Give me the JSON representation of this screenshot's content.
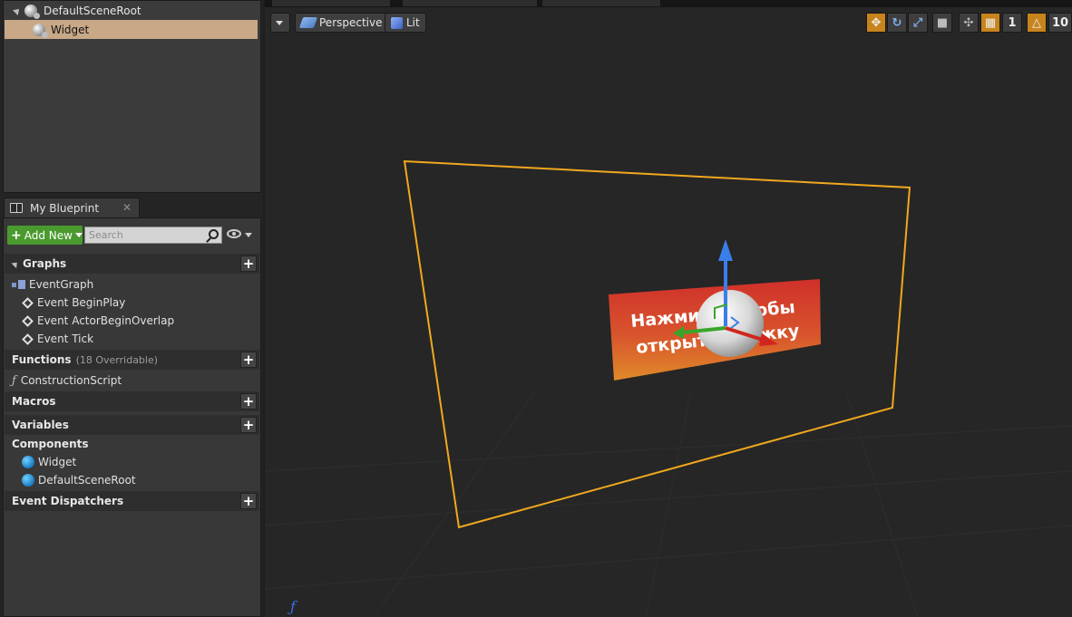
{
  "tree": {
    "root_label": "DefaultSceneRoot",
    "child_label": "Widget"
  },
  "my_blueprint": {
    "tab_label": "My Blueprint",
    "add_new_label": "Add New",
    "search_placeholder": "Search",
    "graphs": {
      "label": "Graphs",
      "items": [
        "EventGraph",
        "Event BeginPlay",
        "Event ActorBeginOverlap",
        "Event Tick"
      ]
    },
    "functions": {
      "label": "Functions",
      "overridable": "(18 Overridable)",
      "items": [
        "ConstructionScript"
      ]
    },
    "macros_label": "Macros",
    "variables_label": "Variables",
    "components": {
      "label": "Components",
      "items": [
        "Widget",
        "DefaultSceneRoot"
      ]
    },
    "event_dispatchers_label": "Event Dispatchers"
  },
  "viewport": {
    "perspective_label": "Perspective",
    "lit_label": "Lit",
    "speed_value": "1",
    "camera_speed_partial": "10",
    "widget_text_line1": "Нажмите, чтобы",
    "widget_text_line2": "открыть книжку"
  },
  "colors": {
    "selection": "#c8a886",
    "add_new_green": "#4a9a2e",
    "bounds_orange": "#f0a81e",
    "toolbar_active": "#c8841c"
  }
}
